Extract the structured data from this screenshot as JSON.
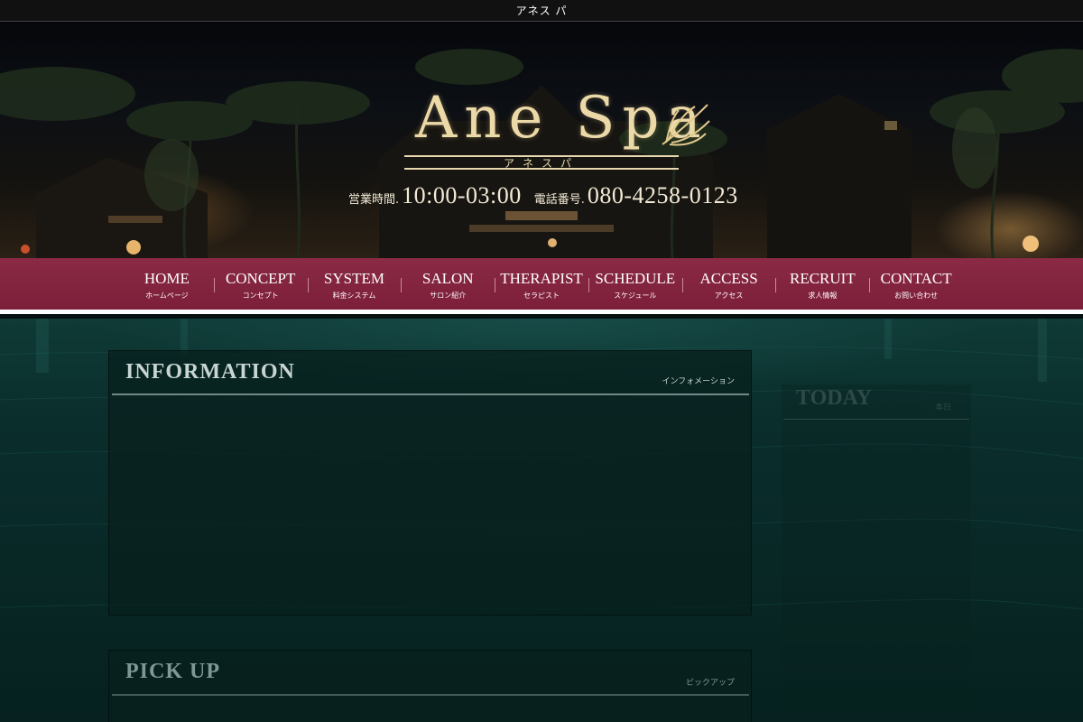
{
  "topbar": {
    "text": "アネス パ"
  },
  "header": {
    "logo_text": "Ane Spa",
    "logo_kana": "アネスパ",
    "hours_label": "営業時間.",
    "hours_value": "10:00-03:00",
    "phone_label": "電話番号.",
    "phone_value": "080-4258-0123"
  },
  "nav": {
    "items": [
      {
        "label": "HOME",
        "sub": "ホームページ"
      },
      {
        "label": "CONCEPT",
        "sub": "コンセプト"
      },
      {
        "label": "SYSTEM",
        "sub": "料金システム"
      },
      {
        "label": "SALON",
        "sub": "サロン紹介"
      },
      {
        "label": "THERAPIST",
        "sub": "セラピスト"
      },
      {
        "label": "SCHEDULE",
        "sub": "スケジュール"
      },
      {
        "label": "ACCESS",
        "sub": "アクセス"
      },
      {
        "label": "RECRUIT",
        "sub": "求人情報"
      },
      {
        "label": "CONTACT",
        "sub": "お問い合わせ"
      }
    ]
  },
  "information": {
    "title": "INFORMATION",
    "subtitle": "インフォメーション"
  },
  "pickup": {
    "title": "PICK UP",
    "subtitle": "ピックアップ"
  },
  "today": {
    "title": "TODAY",
    "subtitle": "本日"
  },
  "colors": {
    "nav_bg": "#7d1f3a",
    "logo_gold": "#ecd9a8",
    "panel_bg": "#08201e"
  }
}
